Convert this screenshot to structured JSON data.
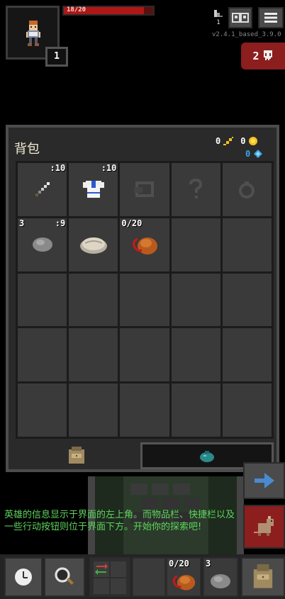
{
  "hero": {
    "hp_text": "18/20",
    "hp_fraction": 0.9,
    "level": "1",
    "portrait_icon": "warrior-hero-icon"
  },
  "top_right": {
    "depth": "1",
    "version": "v2.4.1_based_3.9.0",
    "journal_icon": "journal-icon",
    "menu_icon": "menu-icon",
    "danger_count": "2",
    "danger_icon": "skull-icon"
  },
  "inventory": {
    "title": "背包",
    "gold": "0",
    "energy": "0",
    "keys": "0",
    "slots": [
      {
        "icon": "dagger-icon",
        "qty_tr": ":10"
      },
      {
        "icon": "cloth-armor-icon",
        "qty_tr": ":10"
      },
      {
        "icon": "artifact-slot-icon"
      },
      {
        "icon": "misc-slot-icon"
      },
      {
        "icon": "ring-slot-icon"
      },
      {
        "icon": "throwing-stone-icon",
        "qty_tl": "3",
        "qty_tr": ":9"
      },
      {
        "icon": "food-ration-icon"
      },
      {
        "icon": "waterskin-icon",
        "qty_tl": "0/20"
      }
    ],
    "tabs": [
      {
        "icon": "backpack-icon",
        "active": true
      },
      {
        "icon": "velvet-pouch-icon",
        "active": false
      }
    ]
  },
  "message": {
    "text": "英雄的信息显示于界面的左上角。而物品栏、快捷栏以及一些行动按钮则位于界面下方。开始你的探索吧!"
  },
  "toolbar": {
    "wait_icon": "clock-icon",
    "search_icon": "magnifier-icon",
    "swap_icon": "swap-icon",
    "quickslot1_qty": "0/20",
    "quickslot2_qty": "3",
    "backpack_icon": "backpack-icon",
    "resume_icon": "resume-arrow-icon",
    "attack_icon": "rat-enemy-icon"
  },
  "colors": {
    "hp": "#b01616",
    "message": "#5fd45f",
    "gold": "#f4c21e",
    "energy": "#3aa6e6",
    "danger": "#8c1e1e"
  }
}
